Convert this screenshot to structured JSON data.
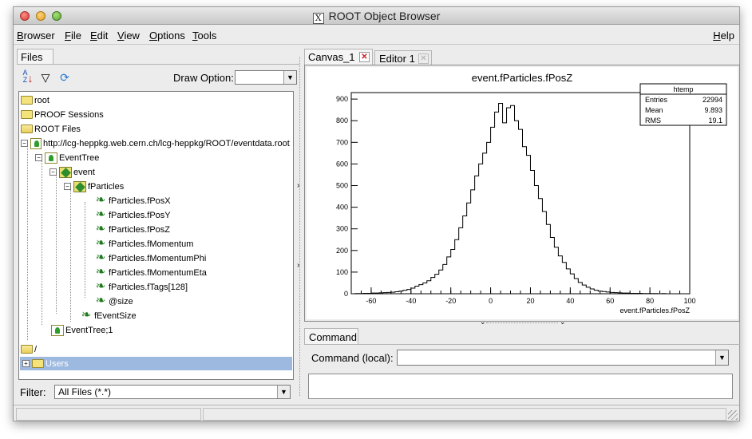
{
  "window": {
    "title": "ROOT Object Browser"
  },
  "menubar": {
    "items": [
      "Browser",
      "File",
      "Edit",
      "View",
      "Options",
      "Tools"
    ],
    "help": "Help"
  },
  "left_panel": {
    "tab": "Files",
    "draw_option_label": "Draw Option:",
    "draw_option_value": "",
    "tree": [
      {
        "label": "root",
        "icon": "folder-icon"
      },
      {
        "label": "PROOF Sessions",
        "icon": "folder-icon"
      },
      {
        "label": "ROOT Files",
        "icon": "open-folder-icon"
      },
      {
        "label": "http://lcg-heppkg.web.cern.ch/lcg-heppkg/ROOT/eventdata.root",
        "icon": "root-file-icon"
      },
      {
        "label": "EventTree",
        "icon": "tree-icon"
      },
      {
        "label": "event",
        "icon": "branch-icon"
      },
      {
        "label": "fParticles",
        "icon": "branch-icon"
      },
      {
        "label": "fParticles.fPosX",
        "icon": "leaf-icon"
      },
      {
        "label": "fParticles.fPosY",
        "icon": "leaf-icon"
      },
      {
        "label": "fParticles.fPosZ",
        "icon": "leaf-icon"
      },
      {
        "label": "fParticles.fMomentum",
        "icon": "leaf-icon"
      },
      {
        "label": "fParticles.fMomentumPhi",
        "icon": "leaf-icon"
      },
      {
        "label": "fParticles.fMomentumEta",
        "icon": "leaf-icon"
      },
      {
        "label": "fParticles.fTags[128]",
        "icon": "leaf-icon"
      },
      {
        "label": "@size",
        "icon": "leaf-icon"
      },
      {
        "label": "fEventSize",
        "icon": "leaf-icon"
      },
      {
        "label": "EventTree;1",
        "icon": "tree-icon"
      },
      {
        "label": "/",
        "icon": "open-folder-icon"
      },
      {
        "label": "Users",
        "icon": "folder-icon"
      }
    ],
    "filter_label": "Filter:",
    "filter_value": "All Files (*.*)"
  },
  "right_panel": {
    "tabs": [
      {
        "label": "Canvas_1",
        "active": true
      },
      {
        "label": "Editor 1",
        "active": false
      }
    ],
    "command_tab": "Command",
    "command_label": "Command (local):",
    "command_value": ""
  },
  "colors": {
    "selection": "#9db9df",
    "leaf": "#1f7a1f",
    "close_active": "#c42020"
  },
  "chart_data": {
    "type": "histogram",
    "title": "event.fParticles.fPosZ",
    "xlabel": "event.fParticles.fPosZ",
    "ylabel": "",
    "xlim": [
      -70,
      100
    ],
    "ylim": [
      0,
      930
    ],
    "x_ticks": [
      -60,
      -40,
      -20,
      0,
      20,
      40,
      60,
      80,
      100
    ],
    "y_ticks": [
      0,
      100,
      200,
      300,
      400,
      500,
      600,
      700,
      800,
      900
    ],
    "bin_edges": [
      -70,
      -68,
      -66,
      -64,
      -62,
      -60,
      -58,
      -56,
      -54,
      -52,
      -50,
      -48,
      -46,
      -44,
      -42,
      -40,
      -38,
      -36,
      -34,
      -32,
      -30,
      -28,
      -26,
      -24,
      -22,
      -20,
      -18,
      -16,
      -14,
      -12,
      -10,
      -8,
      -6,
      -4,
      -2,
      0,
      2,
      4,
      6,
      8,
      10,
      12,
      14,
      16,
      18,
      20,
      22,
      24,
      26,
      28,
      30,
      32,
      34,
      36,
      38,
      40,
      42,
      44,
      46,
      48,
      50,
      52,
      54,
      56,
      58,
      60,
      62,
      64,
      66,
      68,
      70,
      72,
      74,
      76,
      78,
      80,
      82,
      84,
      86,
      88,
      90,
      92,
      94,
      96,
      98,
      100
    ],
    "values": [
      0,
      1,
      1,
      2,
      2,
      3,
      3,
      4,
      5,
      6,
      7,
      9,
      12,
      16,
      20,
      26,
      35,
      42,
      50,
      60,
      75,
      90,
      110,
      135,
      170,
      205,
      250,
      305,
      360,
      420,
      480,
      545,
      600,
      650,
      700,
      770,
      840,
      880,
      790,
      860,
      870,
      800,
      760,
      680,
      640,
      570,
      500,
      440,
      380,
      320,
      260,
      215,
      175,
      145,
      115,
      92,
      70,
      52,
      40,
      30,
      22,
      16,
      12,
      10,
      8,
      6,
      5,
      4,
      3,
      3,
      2,
      2,
      2,
      1,
      1,
      1,
      1,
      0,
      1,
      0,
      0,
      0,
      0,
      0,
      0
    ],
    "stats": {
      "name": "htemp",
      "entries_label": "Entries",
      "entries": "22994",
      "mean_label": "Mean",
      "mean": "9.893",
      "rms_label": "RMS",
      "rms": "19.1"
    }
  }
}
